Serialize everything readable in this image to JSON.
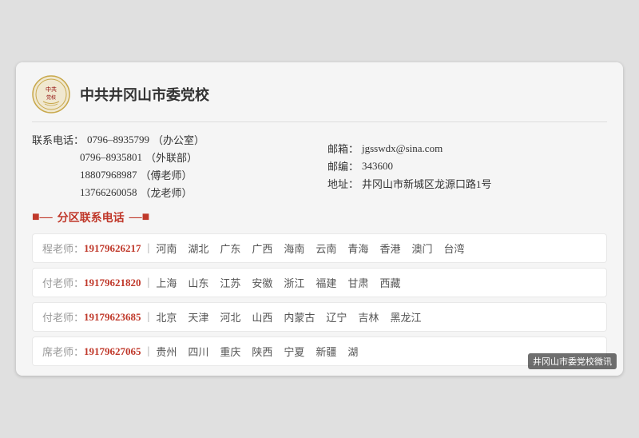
{
  "header": {
    "school_name": "中共井冈山市委党校"
  },
  "contact": {
    "phone_label": "联系电话：",
    "phone1_value": "0796–8935799",
    "phone1_note": "（办公室）",
    "phone2_value": "0796–8935801",
    "phone2_note": "（外联部）",
    "phone3_value": "18807968987",
    "phone3_note": "（傅老师）",
    "phone4_value": "13766260058",
    "phone4_note": "（龙老师）",
    "email_label": "邮箱：",
    "email_value": "jgsswdx@sina.com",
    "postal_label": "邮编：",
    "postal_value": "343600",
    "address_label": "地址：",
    "address_value": "井冈山市新城区龙源口路1号"
  },
  "section_title": "分区联系电话",
  "regions": [
    {
      "teacher": "程老师：",
      "phone": "19179626217",
      "areas": [
        "河南",
        "湖北",
        "广东",
        "广西",
        "海南",
        "云南",
        "青海",
        "香港",
        "澳门",
        "台湾"
      ]
    },
    {
      "teacher": "付老师：",
      "phone": "19179621820",
      "areas": [
        "上海",
        "山东",
        "江苏",
        "安徽",
        "浙江",
        "福建",
        "甘肃",
        "西藏"
      ]
    },
    {
      "teacher": "付老师：",
      "phone": "19179623685",
      "areas": [
        "北京",
        "天津",
        "河北",
        "山西",
        "内蒙古",
        "辽宁",
        "吉林",
        "黑龙江"
      ]
    },
    {
      "teacher": "席老师：",
      "phone": "19179627065",
      "areas": [
        "贵州",
        "四川",
        "重庆",
        "陕西",
        "宁夏",
        "新疆",
        "湖"
      ]
    }
  ],
  "watermark": "井冈山市委党校微讯"
}
